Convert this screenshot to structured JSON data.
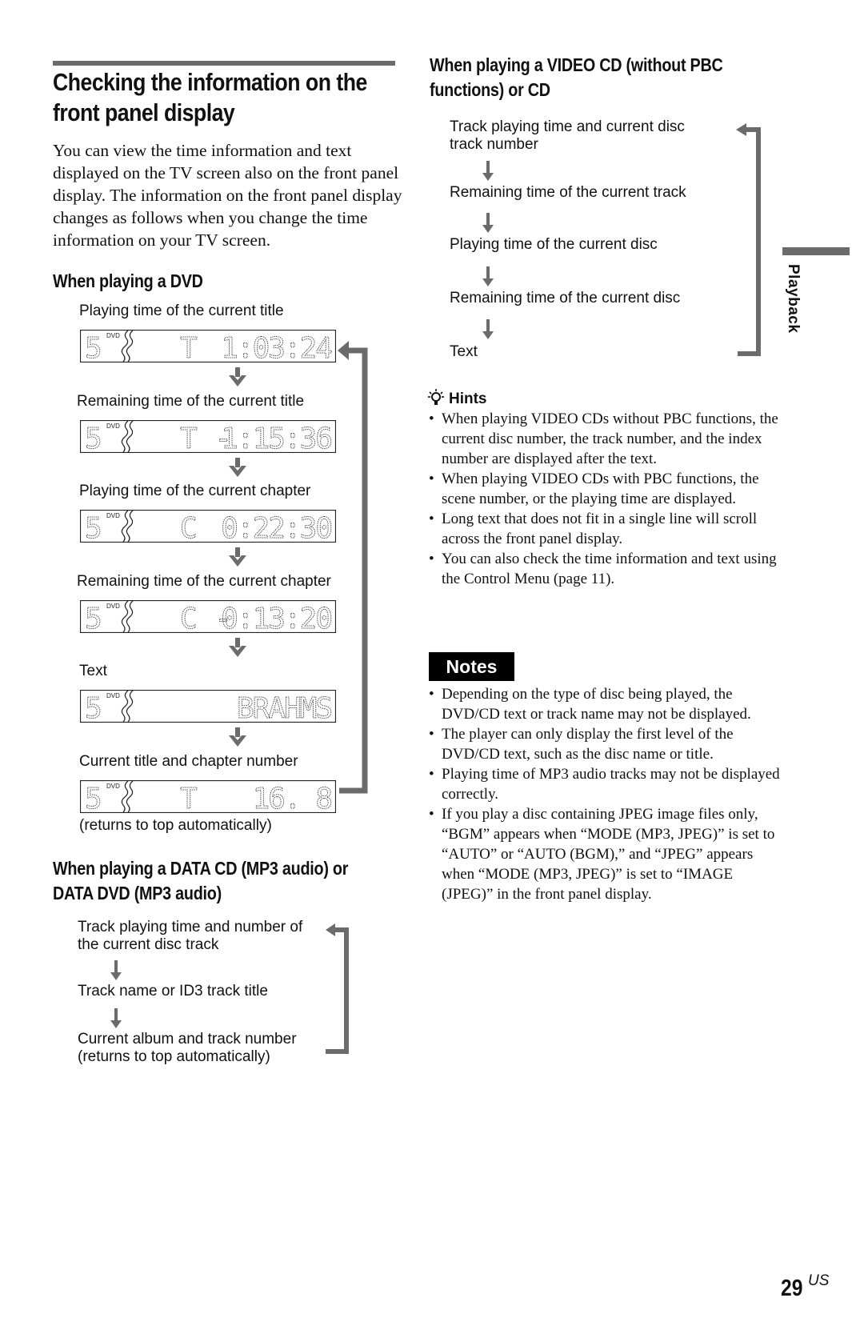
{
  "page": {
    "title": "Checking the information on the front panel display",
    "title_lines": [
      "Checking the information on the",
      "front panel display"
    ],
    "intro": "You can view the time information and text displayed on the TV screen also on the front panel display. The information on the front panel display changes as follows when you change the time information on your TV screen.",
    "side_tab": "Playback",
    "page_number": "29",
    "page_suffix": "US"
  },
  "dvd_section": {
    "heading": "When playing a DVD",
    "steps": [
      {
        "label": "Playing time of the current title",
        "display": {
          "disc": "5",
          "badge": "DVD",
          "mode": "T",
          "value": "1:03:24"
        }
      },
      {
        "label": "Remaining time of the current title",
        "display": {
          "disc": "5",
          "badge": "DVD",
          "mode": "T -",
          "value": "1:15:36"
        }
      },
      {
        "label": "Playing time of the current chapter",
        "display": {
          "disc": "5",
          "badge": "DVD",
          "mode": "C",
          "value": "0:22:30"
        }
      },
      {
        "label": "Remaining time of the current chapter",
        "display": {
          "disc": "5",
          "badge": "DVD",
          "mode": "C -",
          "value": "0:13:20"
        }
      },
      {
        "label": "Text",
        "display": {
          "disc": "5",
          "badge": "DVD",
          "mode": "",
          "value": "BRAHMS"
        }
      },
      {
        "label": "Current title and chapter number",
        "display": {
          "disc": "5",
          "badge": "DVD",
          "mode": "T",
          "value": "16. 8"
        }
      }
    ],
    "footer": "(returns to top automatically)"
  },
  "mp3_section": {
    "heading_lines": [
      "When playing a DATA CD (MP3 audio) or",
      "DATA DVD (MP3 audio)"
    ],
    "steps": [
      [
        "Track playing time and number of",
        "the current disc track"
      ],
      [
        "Track name or ID3 track title"
      ],
      [
        "Current album and track number",
        "(returns to top automatically)"
      ]
    ]
  },
  "vcd_section": {
    "heading_lines": [
      "When playing a VIDEO CD (without PBC",
      "functions) or CD"
    ],
    "steps": [
      [
        "Track playing time and current disc",
        "track number"
      ],
      [
        "Remaining time of the current track"
      ],
      [
        "Playing time of the current disc"
      ],
      [
        "Remaining time of the current disc"
      ],
      [
        "Text"
      ]
    ]
  },
  "hints": {
    "heading": "Hints",
    "icon": "lightbulb-icon",
    "items": [
      "When playing VIDEO CDs without PBC functions, the current disc number, the track number, and the index number are displayed after the text.",
      "When playing VIDEO CDs with PBC functions, the scene number, or the playing time are displayed.",
      "Long text that does not fit in a single line will scroll across the front panel display.",
      "You can also check the time information and text using the Control Menu (page 11)."
    ]
  },
  "notes": {
    "heading": "Notes",
    "items": [
      "Depending on the type of disc being played, the DVD/CD text or track name may not be displayed.",
      "The player can only display the first level of the DVD/CD text, such as the disc name or title.",
      "Playing time of MP3 audio tracks may not be displayed correctly.",
      " If you play a disc containing JPEG image files only, “BGM” appears when “MODE (MP3, JPEG)” is set to “AUTO” or “AUTO (BGM),” and “JPEG” appears when “MODE (MP3, JPEG)” is set to “IMAGE (JPEG)” in the front panel display."
    ]
  },
  "colors": {
    "arrow_gray": "#6b6b6b",
    "text": "#111111",
    "badge_bg": "#000000"
  }
}
